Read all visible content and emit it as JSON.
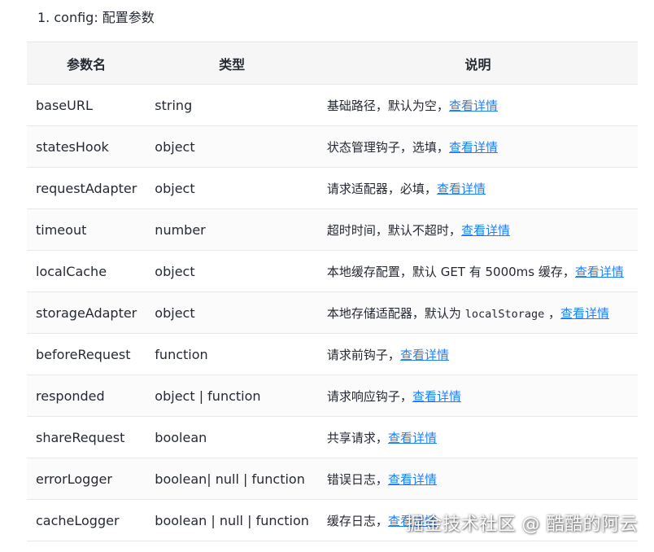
{
  "heading": "1. config: 配置参数",
  "table": {
    "headers": [
      "参数名",
      "类型",
      "说明"
    ],
    "rows": [
      {
        "name": "baseURL",
        "type": "string",
        "desc": "基础路径，默认为空，",
        "code": "",
        "desc_after": "",
        "link": "查看详情"
      },
      {
        "name": "statesHook",
        "type": "object",
        "desc": "状态管理钩子，选填，",
        "code": "",
        "desc_after": "",
        "link": "查看详情"
      },
      {
        "name": "requestAdapter",
        "type": "object",
        "desc": "请求适配器，必填，",
        "code": "",
        "desc_after": "",
        "link": "查看详情"
      },
      {
        "name": "timeout",
        "type": "number",
        "desc": "超时时间，默认不超时，",
        "code": "",
        "desc_after": "",
        "link": "查看详情"
      },
      {
        "name": "localCache",
        "type": "object",
        "desc": "本地缓存配置，默认 GET 有 5000ms 缓存，",
        "code": "",
        "desc_after": "",
        "link": "查看详情"
      },
      {
        "name": "storageAdapter",
        "type": "object",
        "desc": "本地存储适配器，默认为 ",
        "code": "localStorage",
        "desc_after": " ，",
        "link": "查看详情"
      },
      {
        "name": "beforeRequest",
        "type": "function",
        "desc": "请求前钩子，",
        "code": "",
        "desc_after": "",
        "link": "查看详情"
      },
      {
        "name": "responded",
        "type": "object | function",
        "desc": "请求响应钩子，",
        "code": "",
        "desc_after": "",
        "link": "查看详情"
      },
      {
        "name": "shareRequest",
        "type": "boolean",
        "desc": "共享请求，",
        "code": "",
        "desc_after": "",
        "link": "查看详情"
      },
      {
        "name": "errorLogger",
        "type": "boolean| null | function",
        "desc": "错误日志，",
        "code": "",
        "desc_after": "",
        "link": "查看详情"
      },
      {
        "name": "cacheLogger",
        "type": "boolean | null | function",
        "desc": "缓存日志，",
        "code": "",
        "desc_after": "",
        "link": "查看详情"
      }
    ]
  },
  "watermark": "掘金技术社区 @ 酷酷的阿云",
  "colors": {
    "link": "#1e80ff",
    "header_bg": "#f6f6f6",
    "border": "#e8e8e8"
  }
}
